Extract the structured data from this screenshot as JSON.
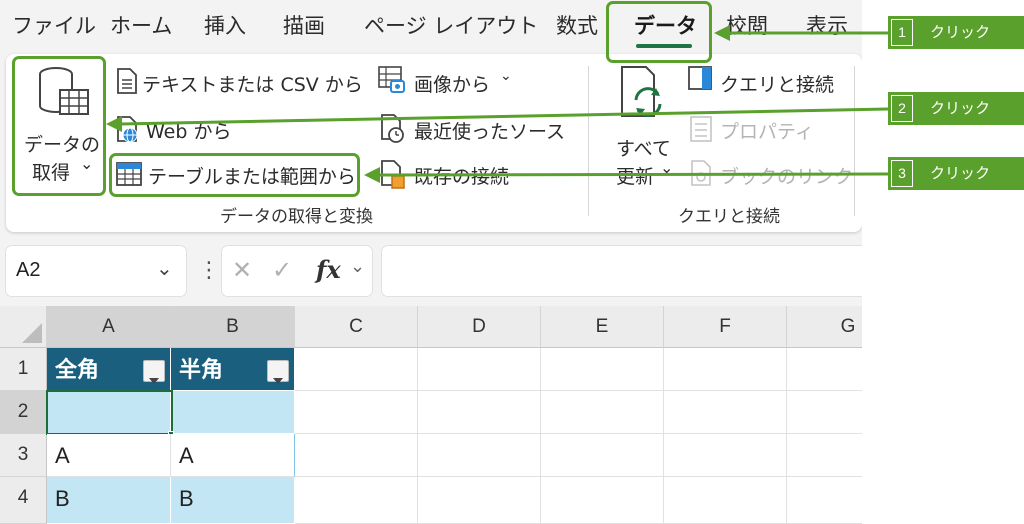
{
  "menu": {
    "tabs": [
      {
        "label": "ファイル"
      },
      {
        "label": "ホーム"
      },
      {
        "label": "挿入"
      },
      {
        "label": "描画"
      },
      {
        "label": "ページ レイアウト"
      },
      {
        "label": "数式"
      },
      {
        "label": "データ",
        "active": true
      },
      {
        "label": "校閲"
      },
      {
        "label": "表示"
      }
    ]
  },
  "ribbon": {
    "get_data": {
      "line1": "データの",
      "line2": "取得",
      "chevron": "⌄"
    },
    "from_text_csv": "テキストまたは CSV から",
    "from_web": "Web から",
    "from_table": "テーブルまたは範囲から",
    "from_image": "画像から",
    "image_chevron": "⌄",
    "recent_sources": "最近使ったソース",
    "existing_connections": "既存の接続",
    "group_get_transform": "データの取得と変換",
    "refresh_all": {
      "line1": "すべて",
      "line2": "更新",
      "chevron": "⌄"
    },
    "queries_connections": "クエリと接続",
    "properties": "プロパティ",
    "edit_links": "ブックのリンク",
    "group_queries": "クエリと接続"
  },
  "formula_bar": {
    "name_box": "A2",
    "fx": "fx",
    "dots": "⋮",
    "cancel": "✕",
    "enter": "✓",
    "formula": ""
  },
  "grid": {
    "columns": [
      "A",
      "B",
      "C",
      "D",
      "E",
      "F",
      "G"
    ],
    "rows": [
      "1",
      "2",
      "3",
      "4"
    ],
    "table": {
      "headers": [
        "全角",
        "半角"
      ],
      "rows": [
        [
          "",
          ""
        ],
        [
          "A",
          "A"
        ],
        [
          "B",
          "B"
        ]
      ]
    }
  },
  "callouts": [
    {
      "num": "1",
      "label": "クリック"
    },
    {
      "num": "2",
      "label": "クリック"
    },
    {
      "num": "3",
      "label": "クリック"
    }
  ],
  "colors": {
    "accent_green": "#5aa02c",
    "excel_green": "#217346",
    "table_header": "#1b5f7e",
    "table_band": "#c3e6f4"
  }
}
